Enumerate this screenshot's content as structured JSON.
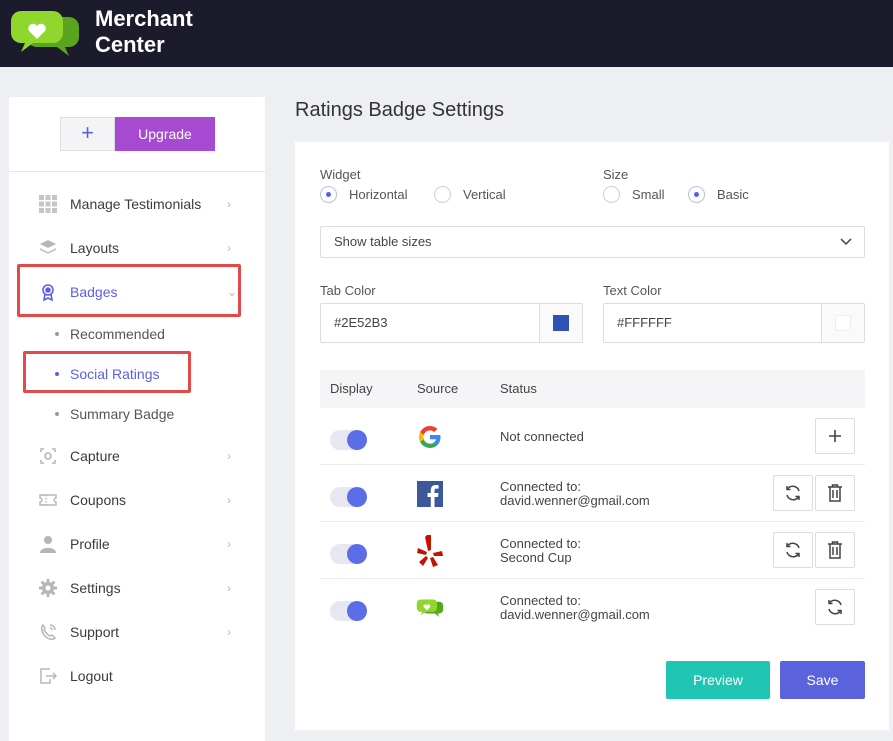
{
  "brand": {
    "line1": "Merchant",
    "line2": "Center"
  },
  "sidebar": {
    "plus_label": "+",
    "upgrade_label": "Upgrade",
    "items": [
      {
        "label": "Manage Testimonials",
        "icon": "grid-icon"
      },
      {
        "label": "Layouts",
        "icon": "layers-icon"
      },
      {
        "label": "Badges",
        "icon": "badge-icon"
      },
      {
        "label": "Capture",
        "icon": "capture-icon"
      },
      {
        "label": "Coupons",
        "icon": "coupon-icon"
      },
      {
        "label": "Profile",
        "icon": "user-icon"
      },
      {
        "label": "Settings",
        "icon": "gear-icon"
      },
      {
        "label": "Support",
        "icon": "support-icon"
      },
      {
        "label": "Logout",
        "icon": "logout-icon"
      }
    ],
    "badges_sub": [
      "Recommended",
      "Social Ratings",
      "Summary Badge"
    ]
  },
  "main": {
    "title": "Ratings Badge Settings",
    "widget_label": "Widget",
    "widget_options": [
      "Horizontal",
      "Vertical"
    ],
    "widget_selected": "Horizontal",
    "size_label": "Size",
    "size_options": [
      "Small",
      "Basic"
    ],
    "size_selected": "Basic",
    "table_sizes": "Show table sizes",
    "tab_color_label": "Tab Color",
    "tab_color_value": "#2E52B3",
    "text_color_label": "Text Color",
    "text_color_value": "#FFFFFF",
    "columns": [
      "Display",
      "Source",
      "Status"
    ],
    "rows": [
      {
        "source": "google-icon",
        "status1": "Not connected",
        "status2": ""
      },
      {
        "source": "facebook-icon",
        "status1": "Connected to:",
        "status2": "david.wenner@gmail.com"
      },
      {
        "source": "yelp-icon",
        "status1": "Connected to:",
        "status2": "Second Cup"
      },
      {
        "source": "merchant-icon",
        "status1": "Connected to:",
        "status2": "david.wenner@gmail.com"
      }
    ],
    "preview_label": "Preview",
    "save_label": "Save"
  },
  "colors": {
    "header": "#1c1b2b",
    "accent": "#5b60e0",
    "upgrade": "#a54ad1",
    "preview": "#20c5b3",
    "save": "#5b63dc",
    "highlight": "#e24a4a",
    "tab_swatch": "#2E52B3"
  }
}
